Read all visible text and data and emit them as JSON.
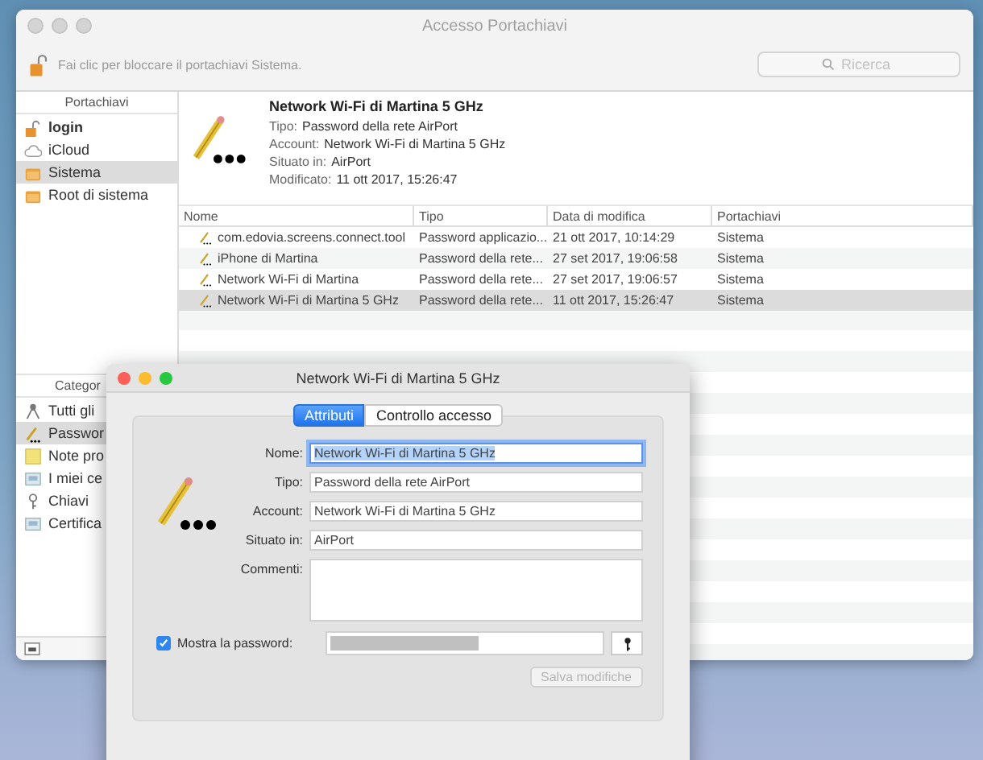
{
  "window": {
    "title": "Accesso Portachiavi",
    "active": false
  },
  "toolbar": {
    "lock_hint": "Fai clic per bloccare il portachiavi Sistema.",
    "search": {
      "placeholder": "Ricerca"
    }
  },
  "sidebar": {
    "keychains_header": "Portachiavi",
    "keychains": [
      {
        "label": "login",
        "kind": "lock",
        "bold": true,
        "selected": false
      },
      {
        "label": "iCloud",
        "kind": "cloud",
        "bold": false,
        "selected": false
      },
      {
        "label": "Sistema",
        "kind": "folder",
        "bold": false,
        "selected": true
      },
      {
        "label": "Root di sistema",
        "kind": "folder",
        "bold": false,
        "selected": false
      }
    ],
    "categories_header": "Categor",
    "categories": [
      {
        "label": "Tutti gli",
        "kind": "people",
        "selected": false
      },
      {
        "label": "Passwor",
        "kind": "pencil",
        "selected": true
      },
      {
        "label": "Note pro",
        "kind": "note",
        "selected": false
      },
      {
        "label": "I miei ce",
        "kind": "cert",
        "selected": false
      },
      {
        "label": "Chiavi",
        "kind": "key",
        "selected": false
      },
      {
        "label": "Certifica",
        "kind": "cert",
        "selected": false
      }
    ]
  },
  "detail": {
    "title": "Network Wi-Fi di Martina 5 GHz",
    "fields": [
      {
        "label": "Tipo:",
        "value": "Password della rete AirPort"
      },
      {
        "label": "Account:",
        "value": "Network Wi-Fi di Martina 5 GHz"
      },
      {
        "label": "Situato in:",
        "value": "AirPort"
      },
      {
        "label": "Modificato:",
        "value": "11 ott 2017, 15:26:47"
      }
    ]
  },
  "table": {
    "columns": [
      "Nome",
      "Tipo",
      "Data di modifica",
      "Portachiavi"
    ],
    "rows": [
      {
        "cells": [
          "com.edovia.screens.connect.tool",
          "Password applicazio...",
          "21 ott 2017, 10:14:29",
          "Sistema"
        ],
        "selected": false
      },
      {
        "cells": [
          "iPhone di Martina",
          "Password della rete...",
          "27 set 2017, 19:06:58",
          "Sistema"
        ],
        "selected": false
      },
      {
        "cells": [
          "Network Wi-Fi di Martina",
          "Password della rete...",
          "27 set 2017, 19:06:57",
          "Sistema"
        ],
        "selected": false
      },
      {
        "cells": [
          "Network Wi-Fi di Martina 5 GHz",
          "Password della rete...",
          "11 ott 2017, 15:26:47",
          "Sistema"
        ],
        "selected": true
      }
    ]
  },
  "dialog": {
    "title": "Network Wi-Fi di Martina 5 GHz",
    "tabs": [
      {
        "label": "Attributi",
        "selected": true
      },
      {
        "label": "Controllo accesso",
        "selected": false
      }
    ],
    "fields": [
      {
        "label": "Nome:",
        "value": "Network Wi-Fi di Martina 5 GHz",
        "focused": true,
        "kind": "line"
      },
      {
        "label": "Tipo:",
        "value": "Password della rete AirPort",
        "focused": false,
        "kind": "line"
      },
      {
        "label": "Account:",
        "value": "Network Wi-Fi di Martina 5 GHz",
        "focused": false,
        "kind": "line"
      },
      {
        "label": "Situato in:",
        "value": "AirPort",
        "focused": false,
        "kind": "line"
      },
      {
        "label": "Commenti:",
        "kind": "area"
      }
    ],
    "show_password": {
      "label": "Mostra la password:",
      "checked": true
    },
    "save_button": {
      "label": "Salva modifiche",
      "disabled": true
    }
  }
}
